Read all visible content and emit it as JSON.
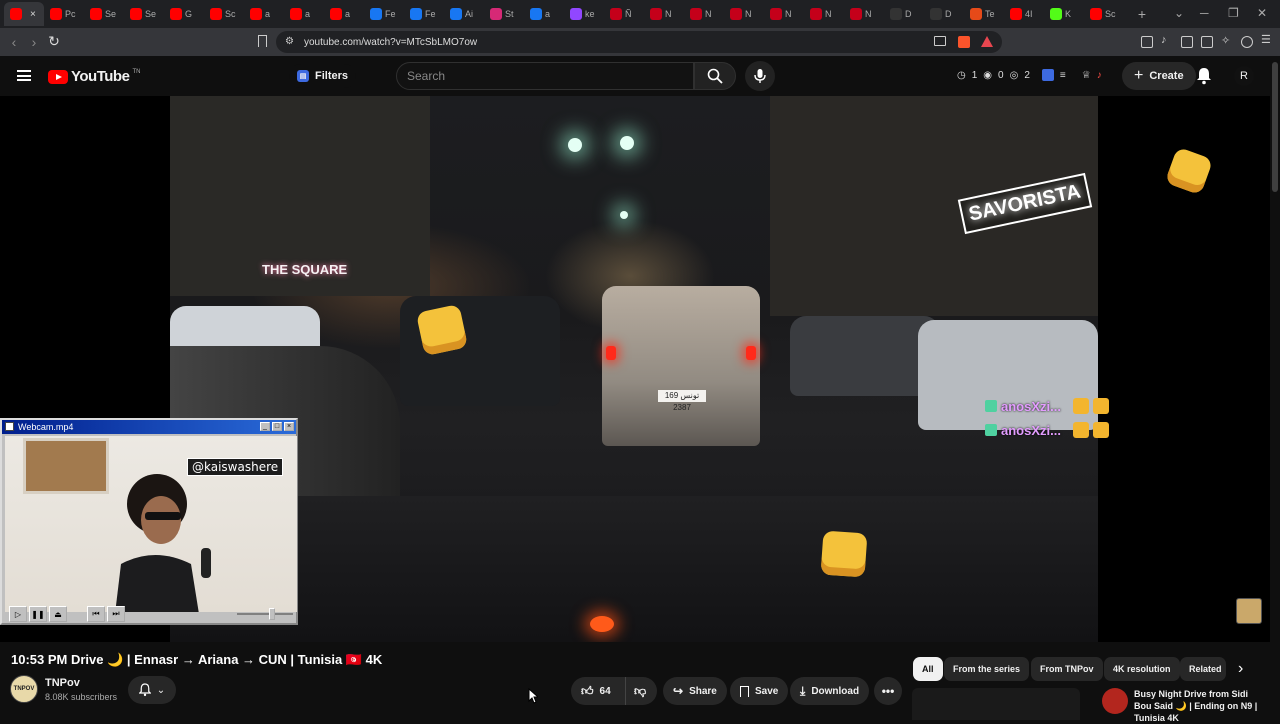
{
  "browser": {
    "tabs": [
      {
        "label": "",
        "color": "#ff0000"
      },
      {
        "label": "Pc",
        "color": "#ff0000"
      },
      {
        "label": "Se",
        "color": "#ff0000"
      },
      {
        "label": "Se",
        "color": "#ff0000"
      },
      {
        "label": "G",
        "color": "#ff0000"
      },
      {
        "label": "Sc",
        "color": "#ff0000"
      },
      {
        "label": "a",
        "color": "#ff0000"
      },
      {
        "label": "a",
        "color": "#ff0000"
      },
      {
        "label": "a",
        "color": "#ff0000"
      },
      {
        "label": "Fe",
        "color": "#1877f2"
      },
      {
        "label": "Fe",
        "color": "#1877f2"
      },
      {
        "label": "Ai",
        "color": "#1877f2"
      },
      {
        "label": "St",
        "color": "#d62976"
      },
      {
        "label": "a",
        "color": "#1877f2"
      },
      {
        "label": "ke",
        "color": "#9147ff"
      },
      {
        "label": "Ñ",
        "color": "#c4001a"
      },
      {
        "label": "N",
        "color": "#c4001a"
      },
      {
        "label": "N",
        "color": "#c4001a"
      },
      {
        "label": "N",
        "color": "#c4001a"
      },
      {
        "label": "N",
        "color": "#c4001a"
      },
      {
        "label": "N",
        "color": "#c4001a"
      },
      {
        "label": "N",
        "color": "#c4001a"
      },
      {
        "label": "D",
        "color": "#333333"
      },
      {
        "label": "D",
        "color": "#333333"
      },
      {
        "label": "Te",
        "color": "#e64a19"
      },
      {
        "label": "4I",
        "color": "#ff0000"
      },
      {
        "label": "K",
        "color": "#53fc18"
      },
      {
        "label": "Sc",
        "color": "#ff0000"
      }
    ],
    "new_tab": "+",
    "url": "youtube.com/watch?v=MTcSbLMO7ow"
  },
  "header": {
    "logo_text": "YouTube",
    "logo_tm": "TN",
    "filters_label": "Filters",
    "search_placeholder": "Search",
    "stats": [
      "1",
      "0",
      "2"
    ],
    "create_label": "Create",
    "avatar_letter": "R"
  },
  "video": {
    "signs": {
      "square": "THE SQUARE",
      "savorista": "SAVORISTA"
    },
    "plate": "169 تونس 2387",
    "chat": [
      {
        "user": "anosXzi..."
      },
      {
        "user": "anosXzi..."
      }
    ]
  },
  "webcam": {
    "title": "Webcam.mp4",
    "handle": "@kaiswashere"
  },
  "info": {
    "title": "10:53 PM Drive 🌙 | Ennasr → Ariana → CUN | Tunisia 🇹🇳 4K",
    "channel_avatar_text": "TNPOV",
    "channel_name": "TNPov",
    "subscribers": "8.08K subscribers",
    "likes": "64",
    "share_label": "Share",
    "save_label": "Save",
    "download_label": "Download"
  },
  "chips": [
    "All",
    "From the series",
    "From TNPov",
    "4K resolution",
    "Related"
  ],
  "related": {
    "title": "Busy Night Drive from Sidi Bou Said 🌙 | Ending on N9 | Tunisia 4K"
  },
  "colors": {
    "yt_red": "#ff0000",
    "background": "#0f0f0f",
    "chat_name": "#e39cff"
  }
}
